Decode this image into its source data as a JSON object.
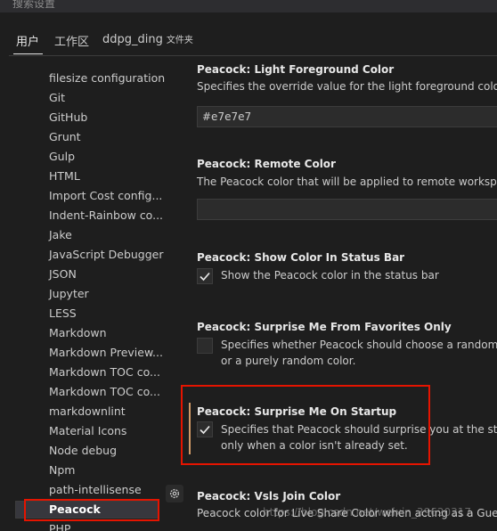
{
  "search": {
    "placeholder": "搜索设置"
  },
  "tabs": {
    "user": "用户",
    "workspace": "工作区",
    "folder": "ddpg_ding",
    "folder_suffix": "文件夹"
  },
  "tree": {
    "items": [
      "filesize configuration",
      "Git",
      "GitHub",
      "Grunt",
      "Gulp",
      "HTML",
      "Import Cost config...",
      "Indent-Rainbow co...",
      "Jake",
      "JavaScript Debugger",
      "JSON",
      "Jupyter",
      "LESS",
      "Markdown",
      "Markdown Preview...",
      "Markdown TOC co...",
      "Markdown TOC co...",
      "markdownlint",
      "Material Icons",
      "Node debug",
      "Npm",
      "path-intellisense",
      "Peacock",
      "PHP"
    ],
    "selected": "Peacock"
  },
  "settings": {
    "light_fg": {
      "title": "Peacock: Light Foreground Color",
      "desc": "Specifies the override value for the light foreground color",
      "value": "#e7e7e7"
    },
    "remote": {
      "title": "Peacock: Remote Color",
      "desc": "The Peacock color that will be applied to remote workspaces",
      "value": ""
    },
    "status_bar": {
      "title": "Peacock: Show Color In Status Bar",
      "desc": "Show the Peacock color in the status bar",
      "checked": true
    },
    "favorites": {
      "title": "Peacock: Surprise Me From Favorites Only",
      "desc1": "Specifies whether Peacock should choose a random color from favorites",
      "desc2": "or a purely random color.",
      "checked": false
    },
    "startup": {
      "title": "Peacock: Surprise Me On Startup",
      "desc1": "Specifies that Peacock should surprise you at the start",
      "desc2": "only when a color isn't already set.",
      "checked": true
    },
    "vsls": {
      "title": "Peacock: Vsls Join Color",
      "desc": "Peacock color for Live Share Color when acting as a Guest"
    }
  },
  "icons": {
    "gear": "gear-icon",
    "check": "check-icon"
  },
  "colors": {
    "accent": "#e51400",
    "focus": "#d19a66"
  },
  "watermark": "https://blog.csdn.net/weixin_39620317"
}
